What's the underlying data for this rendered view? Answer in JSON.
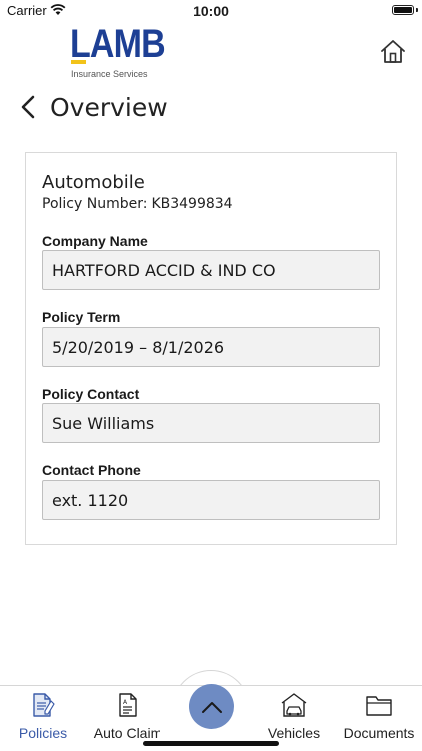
{
  "status_bar": {
    "carrier": "Carrier",
    "time": "10:00"
  },
  "header": {
    "logo_word": "LAMB",
    "logo_sub": "Insurance Services",
    "back_title": "Overview",
    "brand_color": "#1d3f94",
    "brand_accent": "#f2c31a"
  },
  "policy": {
    "type": "Automobile",
    "number_label": "Policy Number:",
    "number": "KB3499834",
    "fields": [
      {
        "label": "Company Name",
        "value": "HARTFORD ACCID & IND CO"
      },
      {
        "label": "Policy Term",
        "value": "5/20/2019 – 8/1/2026"
      },
      {
        "label": "Policy Contact",
        "value": "Sue Williams"
      },
      {
        "label": "Contact Phone",
        "value": "ext. 1120"
      }
    ]
  },
  "tabbar": {
    "tabs": [
      {
        "label": "Policies",
        "icon": "document-icon",
        "active": true
      },
      {
        "label": "Auto Claim",
        "icon": "claim-form-icon",
        "active": false
      },
      {
        "label": "Vehicles",
        "icon": "garage-car-icon",
        "active": false
      },
      {
        "label": "Documents",
        "icon": "folder-icon",
        "active": false
      }
    ],
    "center_button_icon": "chevron-up-icon",
    "accent_color": "#3b5ba8"
  }
}
